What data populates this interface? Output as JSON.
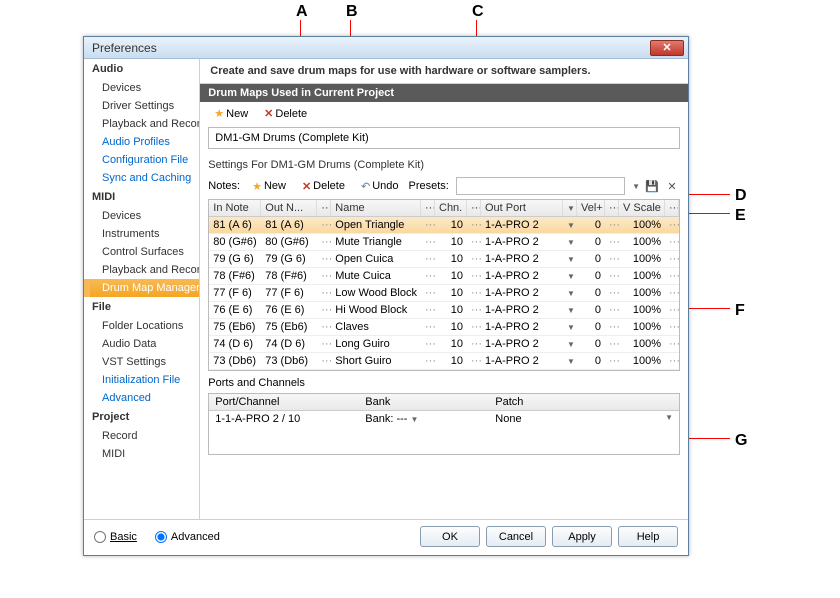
{
  "title": "Preferences",
  "callouts": {
    "a": "A",
    "b": "B",
    "c": "C",
    "d": "D",
    "e": "E",
    "f": "F",
    "g": "G"
  },
  "sidebar": {
    "cats": [
      "Audio",
      "MIDI",
      "File",
      "Project"
    ],
    "audio_items": [
      "Devices",
      "Driver Settings",
      "Playback and Recording",
      "Audio Profiles",
      "Configuration File",
      "Sync and Caching"
    ],
    "midi_items": [
      "Devices",
      "Instruments",
      "Control Surfaces",
      "Playback and Recording",
      "Drum Map Manager"
    ],
    "file_items": [
      "Folder Locations",
      "Audio Data",
      "VST Settings",
      "Initialization File",
      "Advanced"
    ],
    "project_items": [
      "Record",
      "MIDI"
    ]
  },
  "desc": "Create and save drum maps for use with hardware or software samplers.",
  "section1_hdr": "Drum Maps Used in Current Project",
  "tb": {
    "new": "New",
    "delete": "Delete",
    "undo": "Undo",
    "presets": "Presets:"
  },
  "current_map": "DM1-GM Drums (Complete Kit)",
  "settings_for": "Settings For DM1-GM Drums (Complete Kit)",
  "notes_label": "Notes:",
  "grid_hdr": {
    "in": "In Note",
    "out": "Out N...",
    "name": "Name",
    "chn": "Chn.",
    "port": "Out Port",
    "vel": "Vel+",
    "vs": "V Scale"
  },
  "rows": [
    {
      "in": "81 (A 6)",
      "out": "81 (A 6)",
      "name": "Open Triangle",
      "chn": "10",
      "port": "1-A-PRO 2",
      "vel": "0",
      "vs": "100%"
    },
    {
      "in": "80 (G#6)",
      "out": "80 (G#6)",
      "name": "Mute Triangle",
      "chn": "10",
      "port": "1-A-PRO 2",
      "vel": "0",
      "vs": "100%"
    },
    {
      "in": "79 (G 6)",
      "out": "79 (G 6)",
      "name": "Open Cuica",
      "chn": "10",
      "port": "1-A-PRO 2",
      "vel": "0",
      "vs": "100%"
    },
    {
      "in": "78 (F#6)",
      "out": "78 (F#6)",
      "name": "Mute Cuica",
      "chn": "10",
      "port": "1-A-PRO 2",
      "vel": "0",
      "vs": "100%"
    },
    {
      "in": "77 (F 6)",
      "out": "77 (F 6)",
      "name": "Low Wood Block",
      "chn": "10",
      "port": "1-A-PRO 2",
      "vel": "0",
      "vs": "100%"
    },
    {
      "in": "76 (E 6)",
      "out": "76 (E 6)",
      "name": "Hi Wood Block",
      "chn": "10",
      "port": "1-A-PRO 2",
      "vel": "0",
      "vs": "100%"
    },
    {
      "in": "75 (Eb6)",
      "out": "75 (Eb6)",
      "name": "Claves",
      "chn": "10",
      "port": "1-A-PRO 2",
      "vel": "0",
      "vs": "100%"
    },
    {
      "in": "74 (D 6)",
      "out": "74 (D 6)",
      "name": "Long Guiro",
      "chn": "10",
      "port": "1-A-PRO 2",
      "vel": "0",
      "vs": "100%"
    },
    {
      "in": "73 (Db6)",
      "out": "73 (Db6)",
      "name": "Short Guiro",
      "chn": "10",
      "port": "1-A-PRO 2",
      "vel": "0",
      "vs": "100%"
    }
  ],
  "ports_lbl": "Ports and Channels",
  "ports_hdr": {
    "pc": "Port/Channel",
    "bank": "Bank",
    "patch": "Patch"
  },
  "ports_row": {
    "pc": "1-1-A-PRO 2 / 10",
    "bank": "Bank: ---",
    "patch": "None"
  },
  "footer": {
    "basic": "Basic",
    "advanced": "Advanced",
    "ok": "OK",
    "cancel": "Cancel",
    "apply": "Apply",
    "help": "Help"
  }
}
